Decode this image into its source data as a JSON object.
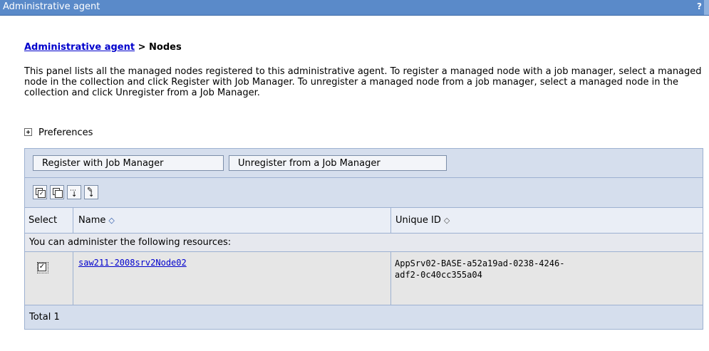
{
  "window": {
    "title": "Administrative agent",
    "help": "?"
  },
  "breadcrumb": {
    "parent": "Administrative agent",
    "separator": " > ",
    "current": "Nodes"
  },
  "description": "This panel lists all the managed nodes registered to this administrative agent. To register a managed node with a job manager, select a managed node in the collection and click Register with Job Manager. To unregister a managed node from a job manager, select a managed node in the collection and click Unregister from a Job Manager.",
  "preferences": {
    "label": "Preferences"
  },
  "toolbar": {
    "register_label": "Register with Job Manager",
    "unregister_label": "Unregister from a Job Manager",
    "icons": [
      "select-all-icon",
      "deselect-all-icon",
      "show-filter-icon",
      "clear-filter-icon"
    ]
  },
  "table": {
    "headers": {
      "select": "Select",
      "name": "Name",
      "unique_id": "Unique ID"
    },
    "sort_glyph": "◇",
    "info": "You can administer the following resources:",
    "rows": [
      {
        "selected": true,
        "name": "saw211-2008srv2Node02",
        "unique_id_line1": "AppSrv02-BASE-a52a19ad-0238-4246-",
        "unique_id_line2": "adf2-0c40cc355a04"
      }
    ],
    "total": "Total 1"
  },
  "colors": {
    "titlebar": "#5a8ac9",
    "panel": "#d5deed",
    "link": "#0000cc"
  }
}
